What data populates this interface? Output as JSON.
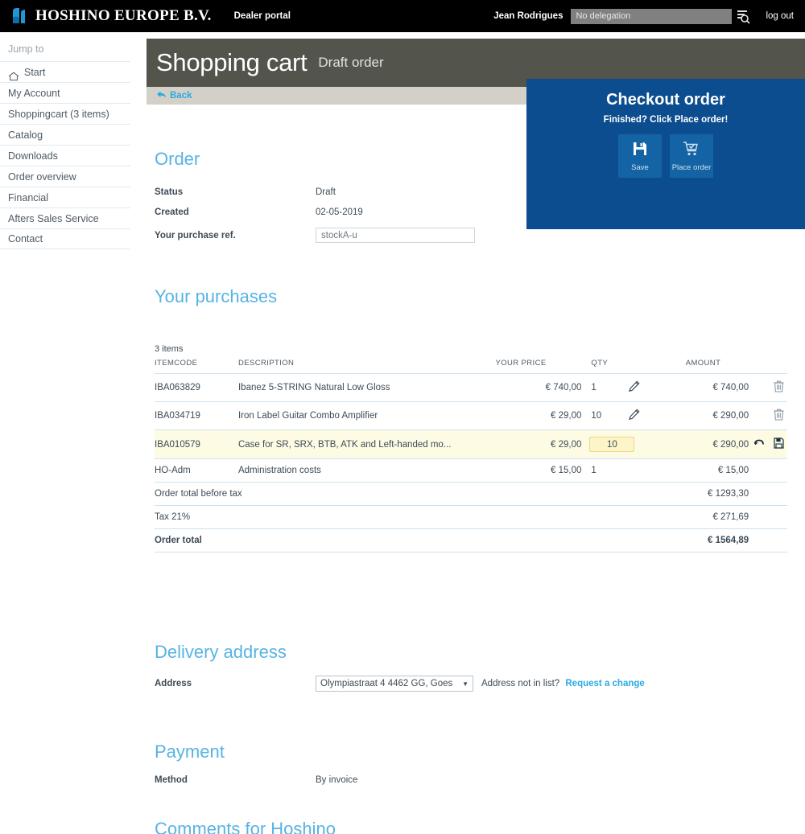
{
  "topbar": {
    "brand": "HOSHINO EUROPE B.V.",
    "portal_label": "Dealer portal",
    "username": "Jean Rodrigues",
    "delegation_value": "No delegation",
    "delegation_icon": "search-list-icon",
    "logout_label": "log out"
  },
  "sidebar": {
    "heading": "Jump to",
    "items": [
      {
        "label": "Start",
        "icon": "home-icon"
      },
      {
        "label": "My Account",
        "icon": ""
      },
      {
        "label": "Shoppingcart (3 items)",
        "icon": ""
      },
      {
        "label": "Catalog",
        "icon": ""
      },
      {
        "label": "Downloads",
        "icon": ""
      },
      {
        "label": "Order overview",
        "icon": ""
      },
      {
        "label": "Financial",
        "icon": ""
      },
      {
        "label": "Afters Sales Service",
        "icon": ""
      },
      {
        "label": "Contact",
        "icon": ""
      }
    ]
  },
  "page": {
    "title": "Shopping cart",
    "subtitle": "Draft order",
    "back_label": "Back",
    "back_icon": "back-arrow-icon"
  },
  "checkout": {
    "title": "Checkout order",
    "subtitle": "Finished? Click Place order!",
    "save_label": "Save",
    "save_icon": "floppy-disk-icon",
    "place_label": "Place order",
    "place_icon": "cart-check-icon"
  },
  "order": {
    "heading": "Order",
    "status_key": "Status",
    "status_value": "Draft",
    "created_key": "Created",
    "created_value": "02-05-2019",
    "ref_key": "Your purchase ref.",
    "ref_value": "stockA-u",
    "ref_placeholder": ""
  },
  "purchases": {
    "heading": "Your purchases",
    "items_count": "3 items",
    "columns": [
      "ITEMCODE",
      "DESCRIPTION",
      "YOUR PRICE",
      "QTY",
      "AMOUNT"
    ],
    "rows": [
      {
        "itemcode": "IBA063829",
        "description": "Ibanez 5-STRING Natural Low Gloss",
        "price": "€ 740,00",
        "qty": "1",
        "amount": "€ 740,00",
        "edit_icon": "pencil-icon",
        "action_icon": "trash-icon",
        "editing": false
      },
      {
        "itemcode": "IBA034719",
        "description": "Iron Label Guitar Combo Amplifier",
        "price": "€ 29,00",
        "qty": "10",
        "amount": "€ 290,00",
        "edit_icon": "pencil-icon",
        "action_icon": "trash-icon",
        "editing": false
      },
      {
        "itemcode": "IBA010579",
        "description": "Case for SR, SRX, BTB, ATK and Left-handed mo...",
        "price": "€ 29,00",
        "qty": "10",
        "amount": "€ 290,00",
        "edit_icon": "",
        "action_icon": "undo-icon",
        "action_icon2": "floppy-disk-icon",
        "editing": true
      },
      {
        "itemcode": "HO-Adm",
        "description": "Administration costs",
        "price": "€ 15,00",
        "qty": "1",
        "amount": "€ 15,00",
        "edit_icon": "",
        "action_icon": "",
        "editing": false
      }
    ],
    "totals": [
      {
        "label": "Order total before tax",
        "value": "€ 1293,30",
        "bold": false
      },
      {
        "label": "Tax 21%",
        "value": "€ 271,69",
        "bold": false
      },
      {
        "label": "Order total",
        "value": "€ 1564,89",
        "bold": true
      }
    ]
  },
  "delivery": {
    "heading": "Delivery address",
    "address_key": "Address",
    "address_selected": "Olympiastraat 4  4462 GG, Goes",
    "note": "Address not in list?",
    "link": "Request a change"
  },
  "payment": {
    "heading": "Payment",
    "method_key": "Method",
    "method_value": "By invoice"
  },
  "comments": {
    "heading": "Comments for Hoshino"
  },
  "colors": {
    "accent_blue": "#57b3e4",
    "link_blue": "#29abe2",
    "checkout_bg": "#0b4d8f",
    "title_bar": "#53544b",
    "back_bar": "#d3d0c8",
    "row_highlight": "#fdfbe4"
  }
}
